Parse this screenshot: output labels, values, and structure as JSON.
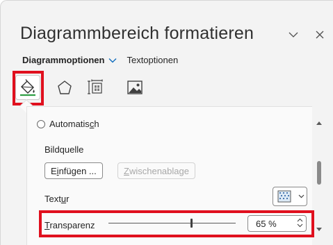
{
  "header": {
    "title": "Diagrammbereich formatieren",
    "collapse_icon": "chevron-down-icon",
    "close_icon": "close-icon"
  },
  "tabs": {
    "active": "Diagrammoptionen",
    "inactive": "Textoptionen"
  },
  "category_icons": [
    "fill-line-icon",
    "effects-pentagon-icon",
    "size-properties-icon",
    "picture-icon"
  ],
  "fill": {
    "radio_automatic_prefix": "Automatis",
    "radio_automatic_accel": "c",
    "radio_automatic_suffix": "h",
    "picture_source_label": "Bildquelle",
    "insert_button_prefix": "E",
    "insert_button_accel": "i",
    "insert_button_suffix": "nfügen ...",
    "clipboard_button_accel": "Z",
    "clipboard_button_suffix": "wischenablage",
    "texture_label_prefix": "Text",
    "texture_label_accel": "u",
    "texture_label_suffix": "r",
    "transparency_label_accel": "T",
    "transparency_label_suffix": "ransparenz",
    "transparency_value": "65 %",
    "transparency_fraction": 0.65
  },
  "colors": {
    "highlight": "#e0101e",
    "accent_chevron": "#0f6cbd"
  }
}
